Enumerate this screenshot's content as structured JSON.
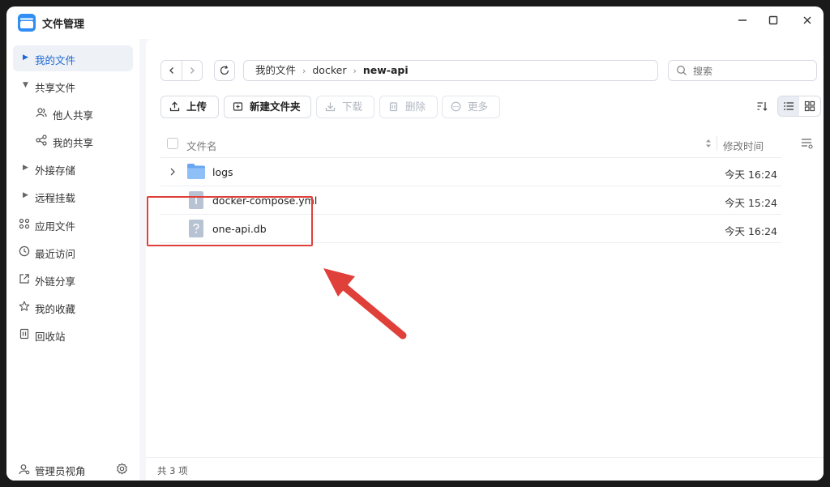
{
  "window": {
    "title": "文件管理",
    "controls": {
      "minimize": "—",
      "maximize": "☐",
      "close": "✕"
    }
  },
  "sidebar": {
    "items": [
      {
        "label": "我的文件",
        "icon": "caret-right-icon",
        "active": true
      },
      {
        "label": "共享文件",
        "icon": "caret-down-icon"
      },
      {
        "label": "他人共享",
        "icon": "users-icon"
      },
      {
        "label": "我的共享",
        "icon": "share-icon"
      },
      {
        "label": "外接存储",
        "icon": "caret-right-icon"
      },
      {
        "label": "远程挂载",
        "icon": "caret-right-icon"
      },
      {
        "label": "应用文件",
        "icon": "apps-icon"
      },
      {
        "label": "最近访问",
        "icon": "clock-icon"
      },
      {
        "label": "外链分享",
        "icon": "external-link-icon"
      },
      {
        "label": "我的收藏",
        "icon": "star-icon"
      },
      {
        "label": "回收站",
        "icon": "trash-icon"
      }
    ],
    "bottom": {
      "label": "管理员视角",
      "icon": "admin-user-icon",
      "settings_icon": "gear-icon"
    }
  },
  "path": {
    "crumbs": [
      "我的文件",
      "docker",
      "new-api"
    ]
  },
  "search": {
    "placeholder": "搜索"
  },
  "toolbar": {
    "upload": "上传",
    "new_folder": "新建文件夹",
    "download": "下载",
    "delete": "删除",
    "more": "更多"
  },
  "table": {
    "columns": {
      "name": "文件名",
      "modified": "修改时间"
    },
    "rows": [
      {
        "name": "logs",
        "type": "folder",
        "modified": "今天 16:24"
      },
      {
        "name": "docker-compose.yml",
        "type": "text-file",
        "modified": "今天 15:24"
      },
      {
        "name": "one-api.db",
        "type": "unknown-file",
        "modified": "今天 16:24"
      }
    ]
  },
  "status": {
    "count": "共 3 项"
  },
  "colors": {
    "accent": "#1a66d2",
    "annotation": "#e0403a",
    "folder": "#6aa7f0",
    "file_icon": "#b7c3d3"
  }
}
